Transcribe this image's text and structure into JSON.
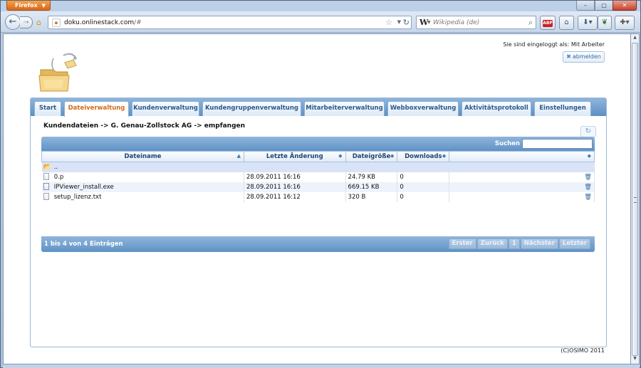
{
  "browser": {
    "menu_button": "Firefox",
    "url_host": "doku.onlinestack.com",
    "url_path": "/#",
    "search_placeholder": "Wikipedia (de)",
    "search_engine_letter": "W",
    "adblock_label": "ABP"
  },
  "page": {
    "login_info": "Sie sind eingeloggt als: Mit Arbeiter",
    "logout_label": "abmelden",
    "breadcrumb": "Kundendateien -> G. Genau-Zollstock AG -> empfangen",
    "search_label": "Suchen",
    "search_value": "",
    "copyright": "(C)OSIMO 2011"
  },
  "tabs": [
    {
      "label": "Start",
      "active": false
    },
    {
      "label": "Dateiverwaltung",
      "active": true
    },
    {
      "label": "Kundenverwaltung",
      "active": false
    },
    {
      "label": "Kundengruppenverwaltung",
      "active": false
    },
    {
      "label": "Mitarbeiterverwaltung",
      "active": false
    },
    {
      "label": "Webboxverwaltung",
      "active": false
    },
    {
      "label": "Aktivitätsprotokoll",
      "active": false
    },
    {
      "label": "Einstellungen",
      "active": false
    }
  ],
  "table": {
    "columns": [
      "Dateiname",
      "Letzte Änderung",
      "Dateigröße",
      "Downloads",
      ""
    ],
    "parent_row": "..",
    "rows": [
      {
        "name": "0.p",
        "modified": "28.09.2011 16:16",
        "size": "24.79 KB",
        "downloads": "0"
      },
      {
        "name": "IPViewer_install.exe",
        "modified": "28.09.2011 16:16",
        "size": "669.15 KB",
        "downloads": "0"
      },
      {
        "name": "setup_lizenz.txt",
        "modified": "28.09.2011 16:12",
        "size": "320 B",
        "downloads": "0"
      }
    ],
    "footer_info": "1 bis 4 von 4 Einträgen",
    "pager": [
      "Erster",
      "Zurück",
      "1",
      "Nächster",
      "Letzter"
    ]
  },
  "colors": {
    "tab_active_text": "#d46a17",
    "header_blue": "#5f92c6",
    "firefox_orange": "#d9661a"
  }
}
